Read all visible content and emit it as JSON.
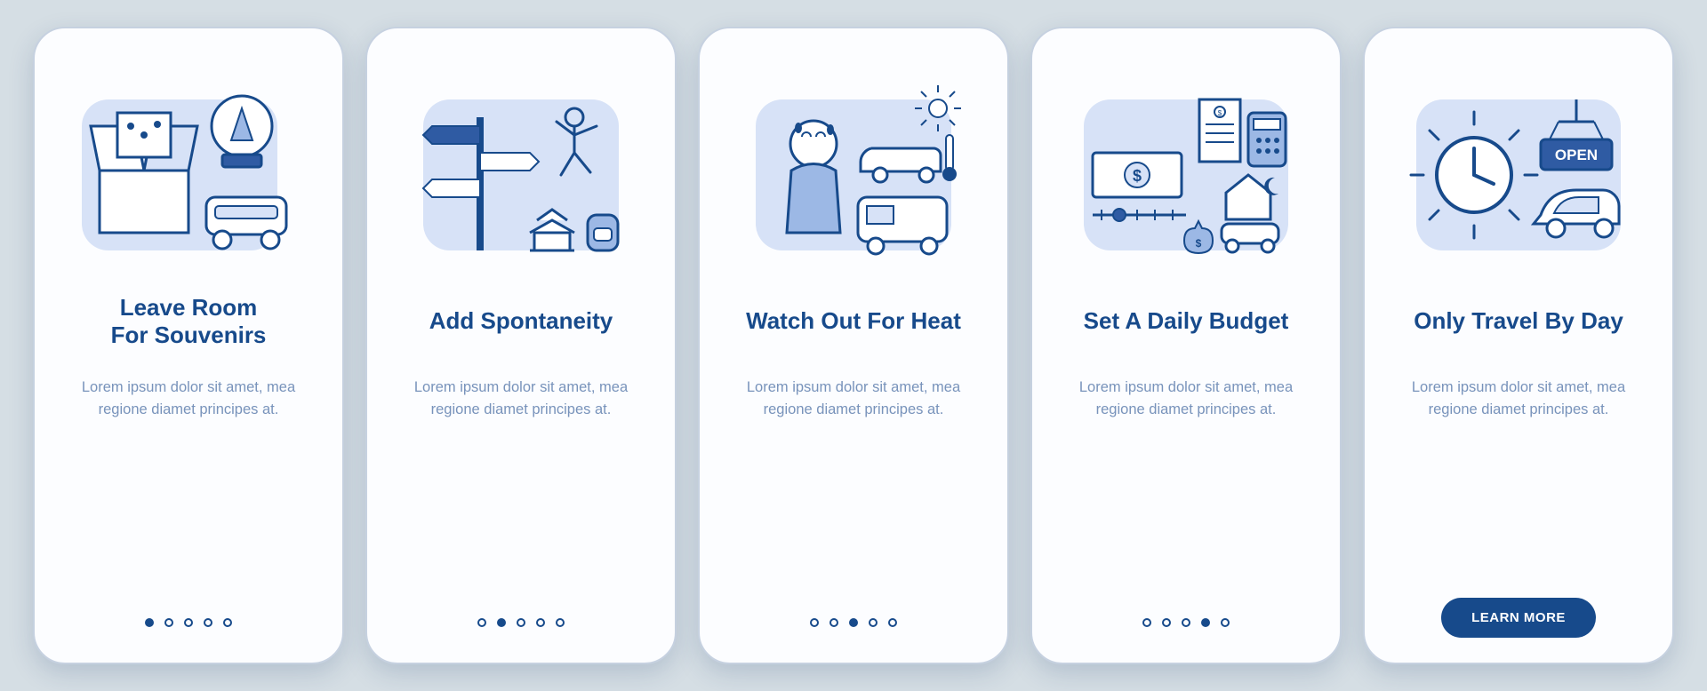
{
  "colors": {
    "brand": "#174a8b",
    "brand_light": "#d7e2f7",
    "brand_mid": "#9cb8e5",
    "accent_dark": "#2f5ba3"
  },
  "cards": [
    {
      "title": "Leave Room\nFor Souvenirs",
      "desc": "Lorem ipsum dolor sit amet, mea regione diamet principes at.",
      "icon": "souvenirs-icon",
      "active_dot": 0,
      "has_cta": false
    },
    {
      "title": "Add Spontaneity",
      "desc": "Lorem ipsum dolor sit amet, mea regione diamet principes at.",
      "icon": "spontaneity-icon",
      "active_dot": 1,
      "has_cta": false
    },
    {
      "title": "Watch Out For Heat",
      "desc": "Lorem ipsum dolor sit amet, mea regione diamet principes at.",
      "icon": "heat-icon",
      "active_dot": 2,
      "has_cta": false
    },
    {
      "title": "Set A Daily Budget",
      "desc": "Lorem ipsum dolor sit amet, mea regione diamet principes at.",
      "icon": "budget-icon",
      "active_dot": 3,
      "has_cta": false
    },
    {
      "title": "Only Travel By Day",
      "desc": "Lorem ipsum dolor sit amet, mea regione diamet principes at.",
      "icon": "daylight-icon",
      "active_dot": 4,
      "has_cta": true
    }
  ],
  "cta_label": "LEARN MORE",
  "dot_count": 5
}
